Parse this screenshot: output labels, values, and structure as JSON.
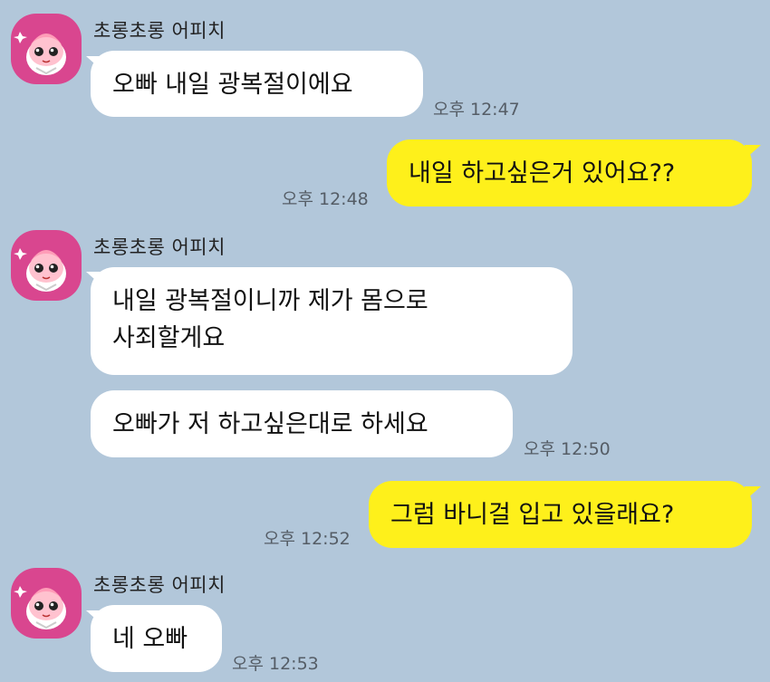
{
  "contact": {
    "name": "초롱초롱 어피치",
    "avatar_icon": "apeach-icon",
    "avatar_color": "#d9468f"
  },
  "colors": {
    "background": "#b2c7da",
    "incoming_bubble": "#ffffff",
    "outgoing_bubble": "#fef01b"
  },
  "messages": [
    {
      "direction": "in",
      "text": "오빠 내일 광복절이에요",
      "time": "오후 12:47"
    },
    {
      "direction": "out",
      "text": "내일 하고싶은거 있어요??",
      "time": "오후 12:48"
    },
    {
      "direction": "in",
      "lines": [
        "내일 광복절이니까 제가 몸으로",
        "사죄할게요"
      ]
    },
    {
      "direction": "in",
      "text": "오빠가 저 하고싶은대로 하세요",
      "time": "오후 12:50"
    },
    {
      "direction": "out",
      "text": "그럼 바니걸 입고 있을래요?",
      "time": "오후 12:52"
    },
    {
      "direction": "in",
      "text": "네 오빠",
      "time": "오후 12:53"
    }
  ]
}
